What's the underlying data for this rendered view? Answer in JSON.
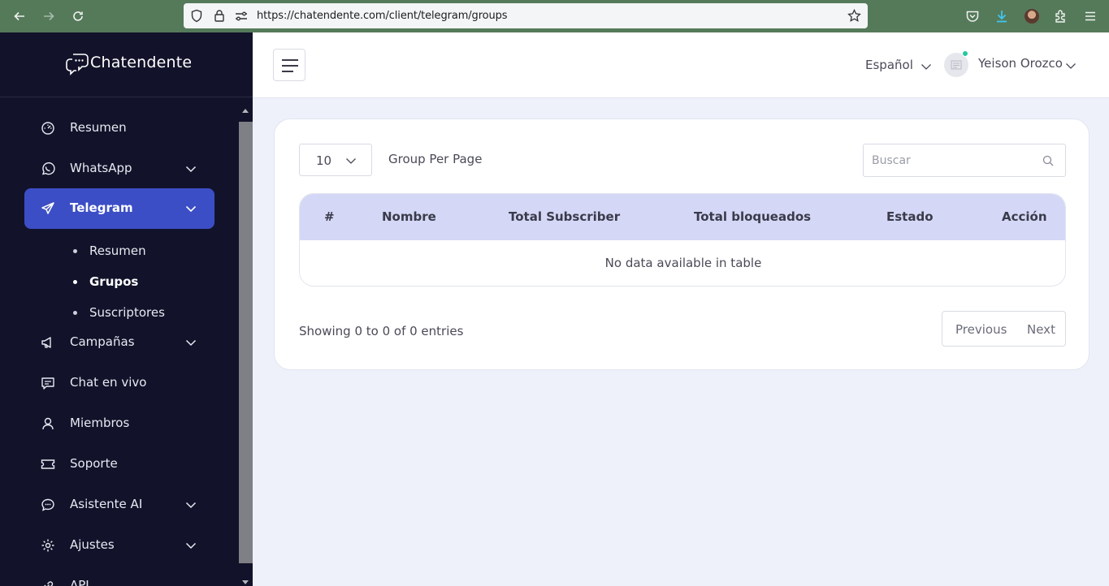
{
  "browser": {
    "url": "https://chatendente.com/client/telegram/groups"
  },
  "sidebar": {
    "brand": "Chatendente",
    "items": [
      {
        "label": "Resumen",
        "icon": "gauge-icon"
      },
      {
        "label": "WhatsApp",
        "icon": "whatsapp-icon",
        "has_children": true
      },
      {
        "label": "Telegram",
        "icon": "telegram-icon",
        "has_children": true,
        "active": true
      },
      {
        "label": "Campañas",
        "icon": "megaphone-icon",
        "has_children": true
      },
      {
        "label": "Chat en vivo",
        "icon": "chat-icon"
      },
      {
        "label": "Miembros",
        "icon": "user-icon"
      },
      {
        "label": "Soporte",
        "icon": "ticket-icon"
      },
      {
        "label": "Asistente AI",
        "icon": "ai-chat-icon",
        "has_children": true
      },
      {
        "label": "Ajustes",
        "icon": "gear-icon",
        "has_children": true
      },
      {
        "label": "API",
        "icon": "link-icon"
      }
    ],
    "telegram_submenu": [
      {
        "label": "Resumen"
      },
      {
        "label": "Grupos",
        "current": true
      },
      {
        "label": "Suscriptores"
      }
    ]
  },
  "header": {
    "language": "Español",
    "user_name": "Yeison Orozco",
    "online_color": "#23c9a0"
  },
  "main": {
    "per_page_value": "10",
    "per_page_label": "Group Per Page",
    "search_placeholder": "Buscar",
    "table": {
      "columns": [
        "#",
        "Nombre",
        "Total Subscriber",
        "Total bloqueados",
        "Estado",
        "Acción"
      ],
      "rows": [],
      "empty_message": "No data available in table"
    },
    "showing_text": "Showing 0 to 0 of 0 entries",
    "pager": {
      "previous": "Previous",
      "next": "Next"
    }
  },
  "colors": {
    "sidebar_bg": "#12132a",
    "accent": "#3c4ec6",
    "table_header_bg": "#d4d8f6",
    "page_bg": "#eef1fa"
  }
}
